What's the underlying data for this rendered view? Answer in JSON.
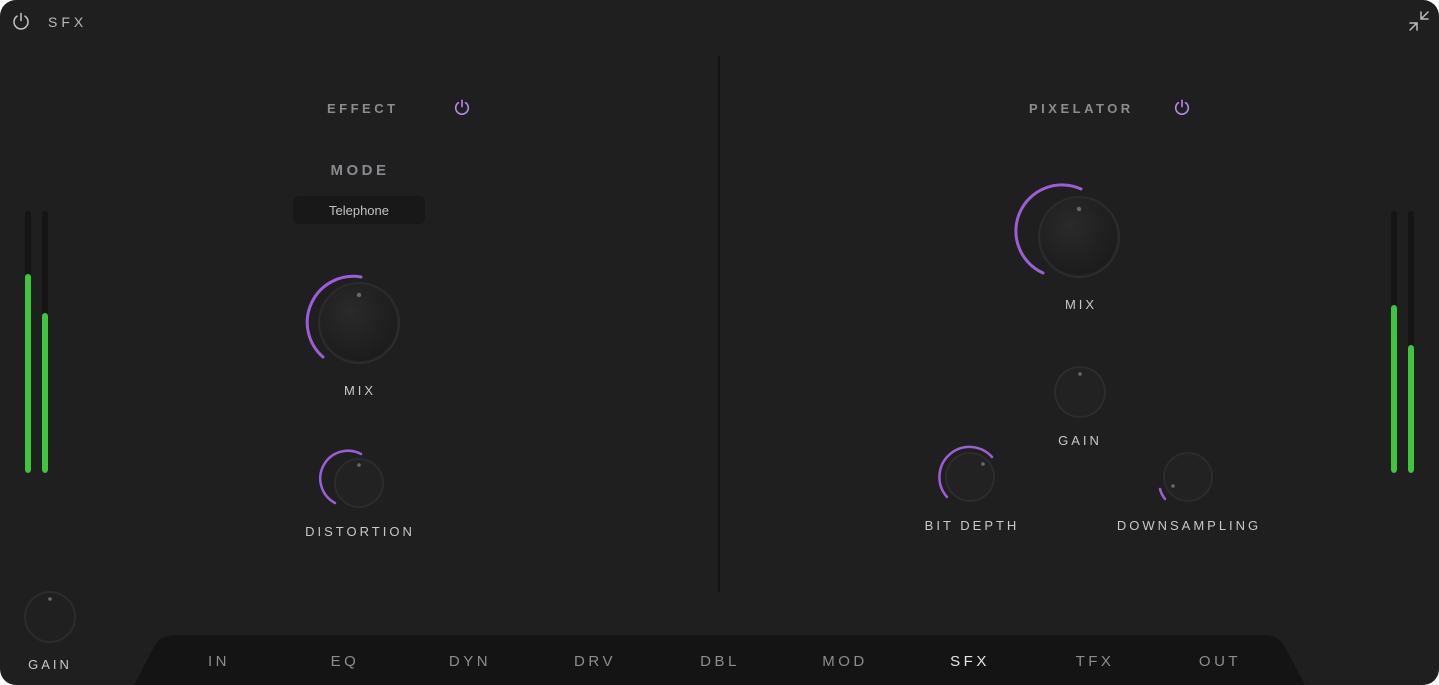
{
  "app": {
    "title": "SFX"
  },
  "left_panel": {
    "section_title": "EFFECT",
    "mode": {
      "label": "MODE",
      "value": "Telephone"
    },
    "mix_label": "MIX",
    "distortion_label": "DISTORTION"
  },
  "right_panel": {
    "section_title": "PIXELATOR",
    "mix_label": "MIX",
    "gain_label": "GAIN",
    "bit_depth_label": "BIT DEPTH",
    "downsampling_label": "DOWNSAMPLING"
  },
  "input_gain": {
    "label": "GAIN"
  },
  "meters": {
    "input_levels": [
      0.76,
      0.61
    ],
    "output_levels": [
      0.64,
      0.49
    ],
    "color": "#3ec63e"
  },
  "tabs": [
    {
      "label": "IN"
    },
    {
      "label": "EQ"
    },
    {
      "label": "DYN"
    },
    {
      "label": "DRV"
    },
    {
      "label": "DBL"
    },
    {
      "label": "MOD"
    },
    {
      "label": "SFX",
      "active": true
    },
    {
      "label": "TFX"
    },
    {
      "label": "OUT"
    }
  ],
  "colors": {
    "accent": "#9a5fd8",
    "meter_green": "#3ec63e",
    "background": "#1f1f20",
    "tabbar": "#141414"
  },
  "icons": {
    "power": "power-icon",
    "collapse": "collapse-arrows-icon"
  }
}
